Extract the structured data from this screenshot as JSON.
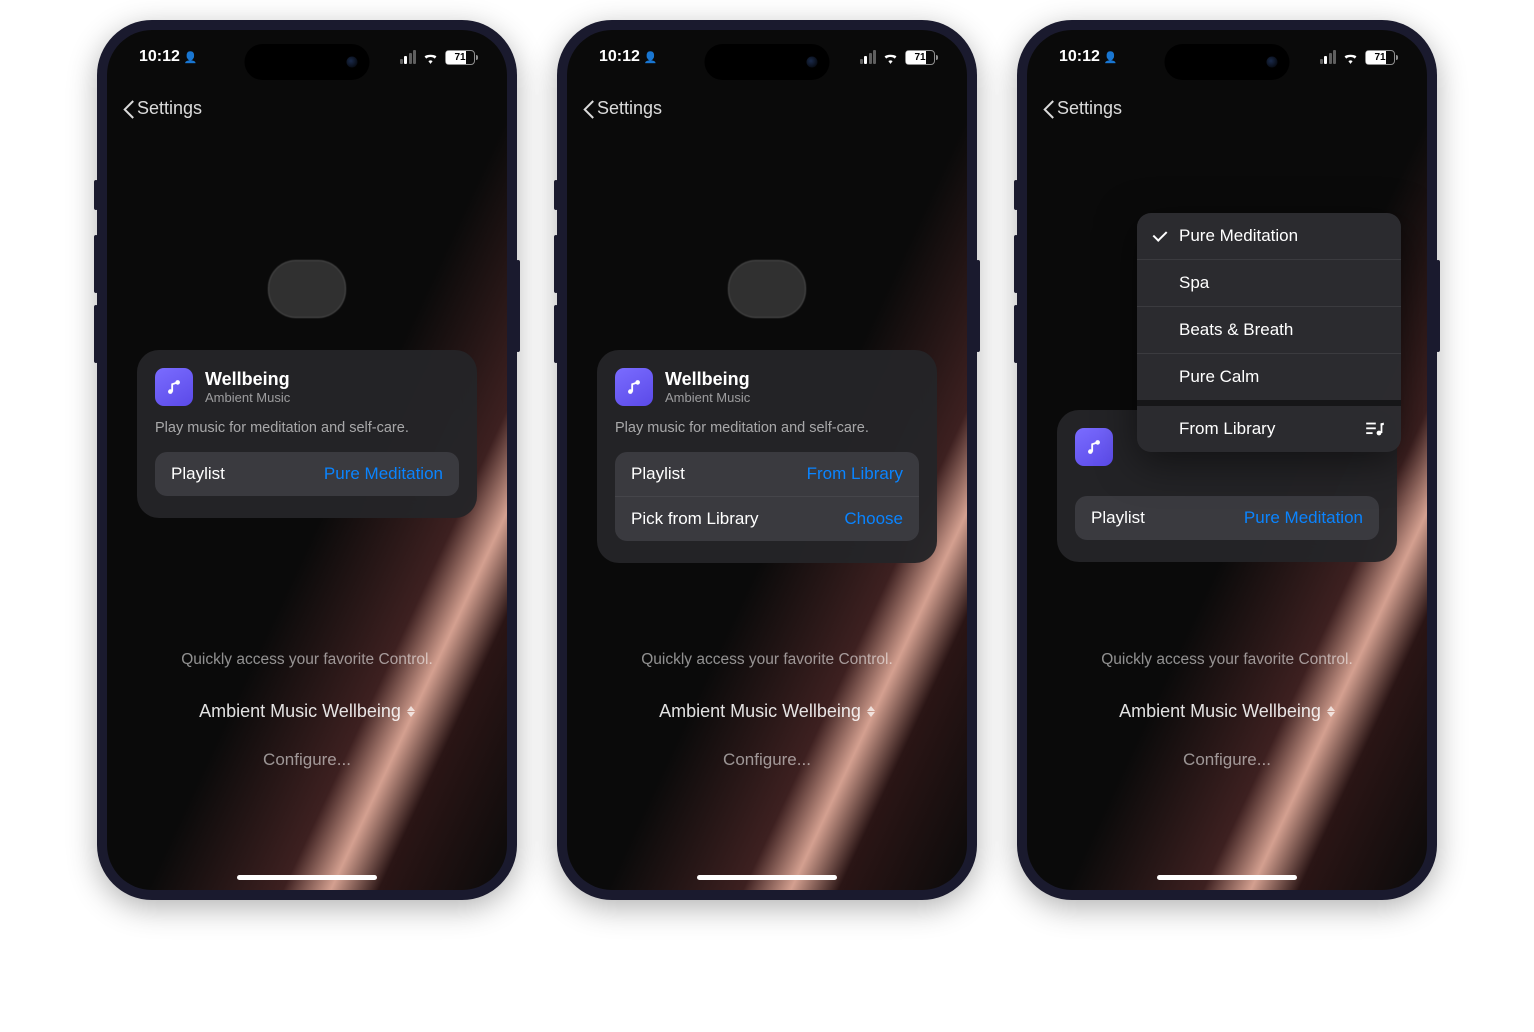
{
  "status": {
    "time": "10:12",
    "battery": "71"
  },
  "nav": {
    "back": "Settings"
  },
  "card": {
    "title": "Wellbeing",
    "subtitle": "Ambient Music",
    "desc": "Play music for meditation and self-care."
  },
  "rows": {
    "playlist_label": "Playlist",
    "playlist_value_1": "Pure Meditation",
    "playlist_value_2": "From Library",
    "pick_label": "Pick from Library",
    "pick_value": "Choose",
    "playlist_value_3": "Pure Meditation"
  },
  "menu": {
    "opt1": "Pure Meditation",
    "opt2": "Spa",
    "opt3": "Beats & Breath",
    "opt4": "Pure Calm",
    "opt5": "From Library"
  },
  "bottom": {
    "hint": "Quickly access your favorite Control.",
    "control": "Ambient Music Wellbeing",
    "configure": "Configure..."
  }
}
